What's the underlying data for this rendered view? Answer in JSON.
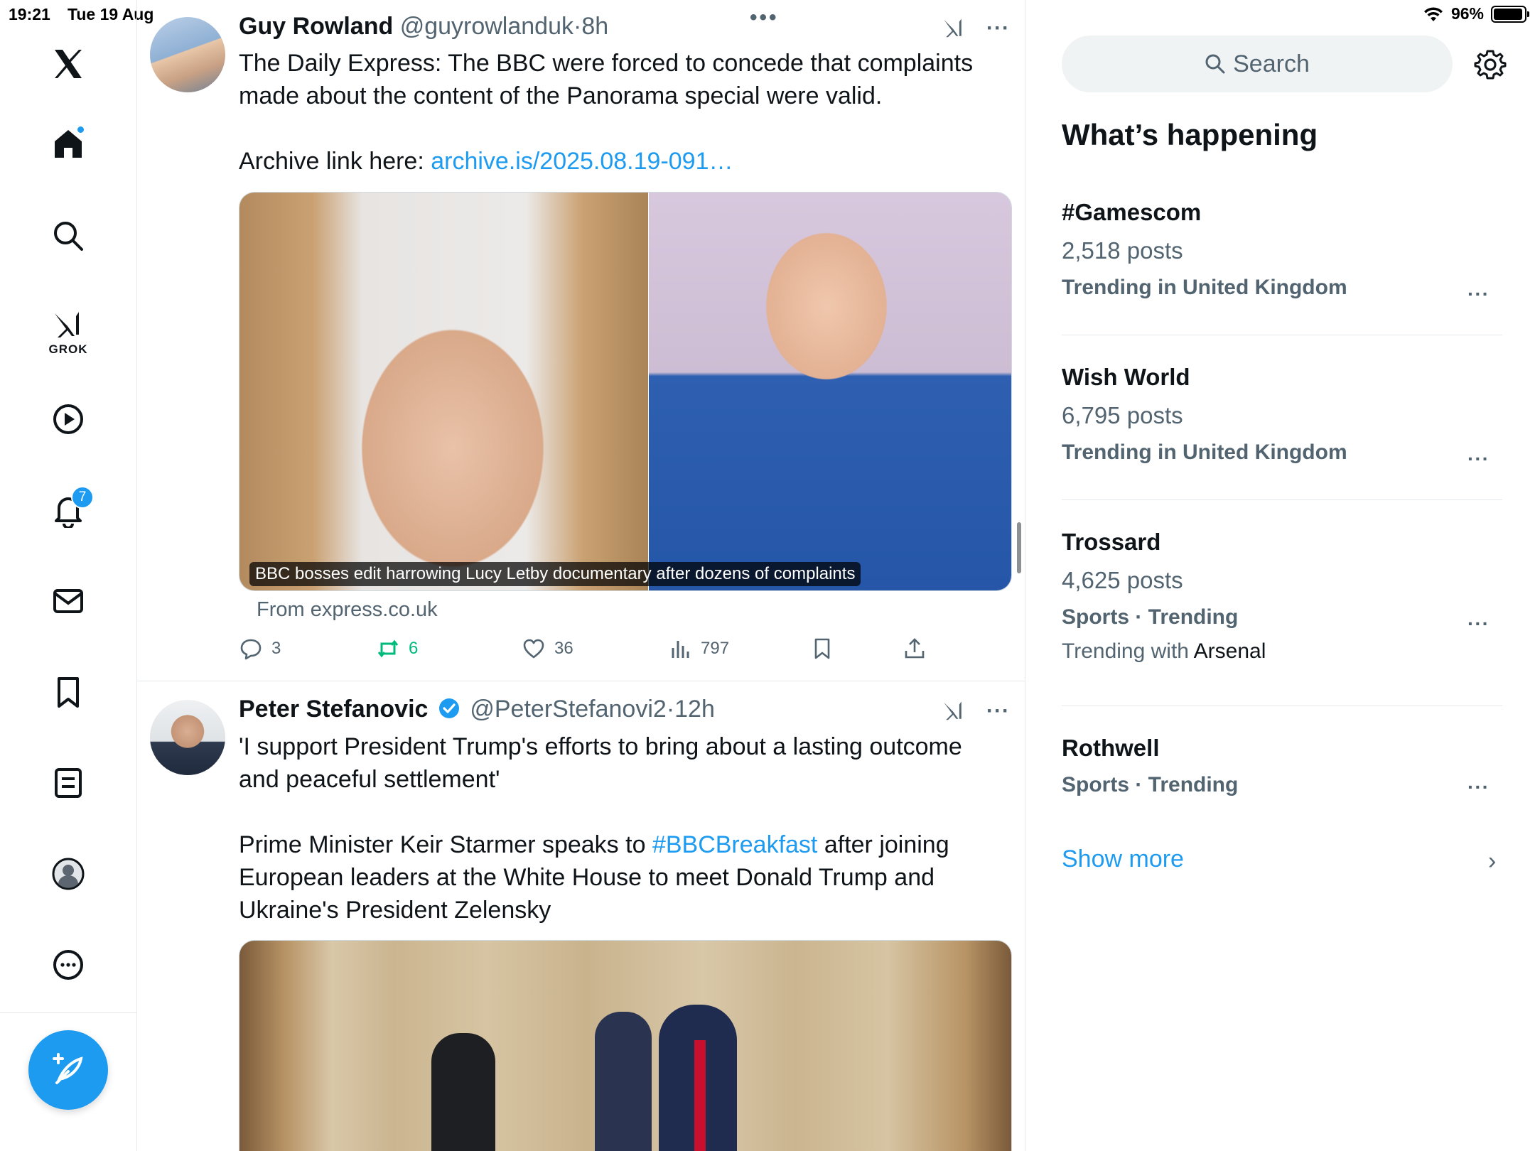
{
  "status_bar": {
    "time": "19:21",
    "date": "Tue 19 Aug",
    "battery": "96%"
  },
  "nav": {
    "grok_label": "GROK",
    "notifications_badge": "7"
  },
  "timeline": {
    "tweets": [
      {
        "name": "Guy Rowland",
        "handle": "@guyrowlanduk",
        "time": "8h",
        "text_line1": "The Daily Express: The BBC were forced to concede that complaints",
        "text_line2": "made about the content of the Panorama special were valid.",
        "archive_prefix": "Archive link here: ",
        "archive_link": "archive.is/2025.08.19-091…",
        "media_caption": "BBC bosses edit harrowing Lucy Letby documentary after dozens of complaints",
        "from": "From express.co.uk",
        "replies": "3",
        "reposts": "6",
        "likes": "36",
        "views": "797"
      },
      {
        "name": "Peter Stefanovic",
        "handle": "@PeterStefanovi2",
        "time": "12h",
        "text_line1": "'I support President Trump's efforts to bring about a lasting outcome",
        "text_line2": "and peaceful settlement'",
        "text2_pre": "Prime Minister Keir Starmer speaks to ",
        "hashtag": "#BBCBreakfast",
        "text2_post": " after joining",
        "text3": "European leaders at the White House to meet Donald Trump and",
        "text4": "Ukraine's President Zelensky"
      }
    ]
  },
  "sidebar": {
    "search_placeholder": "Search",
    "heading": "What’s happening",
    "trends": [
      {
        "title": "#Gamescom",
        "posts": "2,518 posts",
        "context": "Trending in United Kingdom"
      },
      {
        "title": "Wish World",
        "posts": "6,795 posts",
        "context": "Trending in United Kingdom"
      },
      {
        "title": "Trossard",
        "posts": "4,625 posts",
        "context": "Sports · Trending",
        "with_prefix": "Trending with ",
        "with_name": "Arsenal"
      },
      {
        "title": "Rothwell",
        "context": "Sports · Trending"
      }
    ],
    "show_more": "Show more"
  },
  "colors": {
    "accent": "#1d9bf0",
    "repost_green": "#00ba7c",
    "secondary_text": "#536471"
  }
}
